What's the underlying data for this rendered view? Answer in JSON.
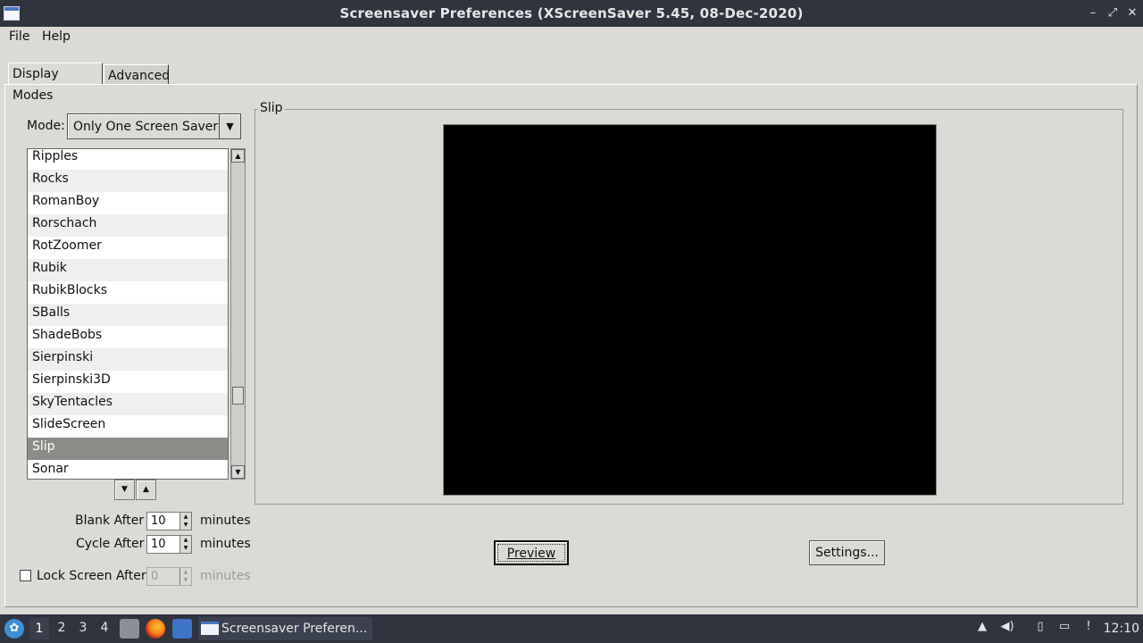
{
  "window": {
    "title": "Screensaver Preferences  (XScreenSaver 5.45, 08-Dec-2020)",
    "minimize": "–",
    "maximize": "⤢",
    "close": "✕"
  },
  "menu": {
    "file": "File",
    "help": "Help"
  },
  "tabs": {
    "display_modes": "Display Modes",
    "advanced": "Advanced"
  },
  "mode": {
    "label": "Mode:",
    "value": "Only One Screen Saver"
  },
  "list": {
    "items": [
      "Ripples",
      "Rocks",
      "RomanBoy",
      "Rorschach",
      "RotZoomer",
      "Rubik",
      "RubikBlocks",
      "SBalls",
      "ShadeBobs",
      "Sierpinski",
      "Sierpinski3D",
      "SkyTentacles",
      "SlideScreen",
      "Slip",
      "Sonar"
    ],
    "selected": "Slip"
  },
  "timing": {
    "blank_label": "Blank After",
    "blank_value": "10",
    "cycle_label": "Cycle After",
    "cycle_value": "10",
    "lock_label": "Lock Screen After",
    "lock_value": "0",
    "unit": "minutes"
  },
  "preview": {
    "frame_label": "Slip",
    "preview_button": "Preview",
    "settings_button": "Settings..."
  },
  "taskbar": {
    "workspaces": [
      "1",
      "2",
      "3",
      "4"
    ],
    "active_workspace": "1",
    "task_label": "Screensaver Preferen...",
    "clock": "12:10"
  }
}
